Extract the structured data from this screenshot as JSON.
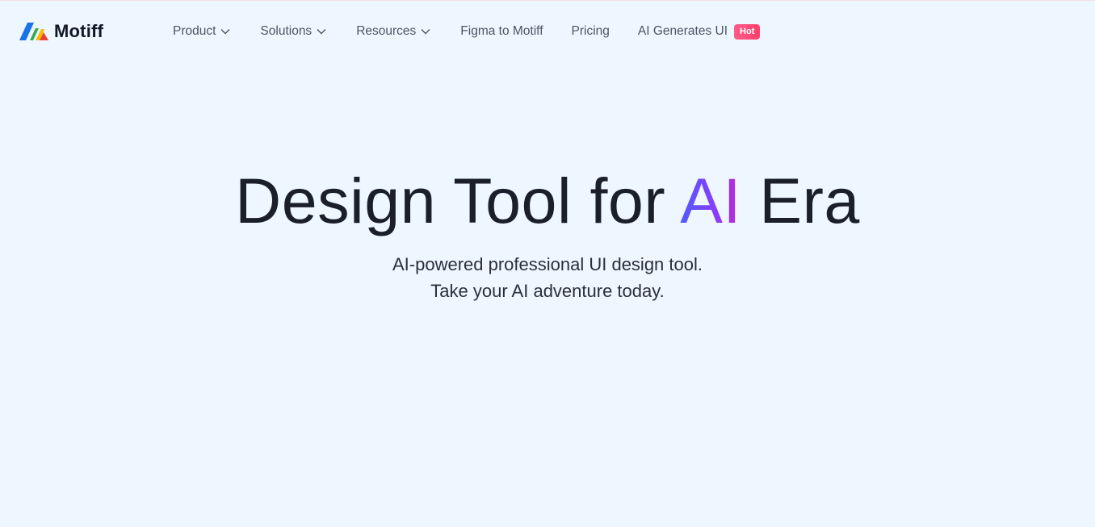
{
  "brand": {
    "name": "Motiff",
    "icon": "motiff-logo-icon",
    "colors": [
      "#1a73e8",
      "#34a853",
      "#ea4335"
    ]
  },
  "nav": {
    "items": [
      {
        "label": "Product",
        "has_dropdown": true
      },
      {
        "label": "Solutions",
        "has_dropdown": true
      },
      {
        "label": "Resources",
        "has_dropdown": true
      },
      {
        "label": "Figma to Motiff",
        "has_dropdown": false
      },
      {
        "label": "Pricing",
        "has_dropdown": false
      },
      {
        "label": "AI Generates UI",
        "has_dropdown": false,
        "badge": "Hot"
      }
    ]
  },
  "hero": {
    "title_before": "Design Tool for ",
    "title_highlight": "AI",
    "title_after": " Era",
    "subtitle_line1": "AI-powered professional UI design tool.",
    "subtitle_line2": "Take your AI adventure today."
  },
  "theme": {
    "background": "#eef6ff",
    "badge_color": "#ff4f7b",
    "gradient_start": "#4f5bff",
    "gradient_end": "#c026d3"
  }
}
